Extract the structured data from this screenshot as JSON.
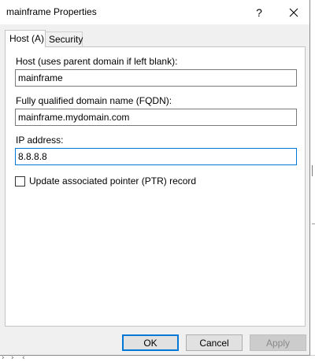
{
  "window": {
    "title": "mainframe Properties",
    "help_glyph": "?"
  },
  "tabs": [
    {
      "label": "Host (A)",
      "active": true
    },
    {
      "label": "Security",
      "active": false
    }
  ],
  "host": {
    "label": "Host (uses parent domain if left blank):",
    "value": "mainframe"
  },
  "fqdn": {
    "label": "Fully qualified domain name (FQDN):",
    "value": "mainframe.mydomain.com"
  },
  "ip": {
    "label": "IP address:",
    "value": "8.8.8.8"
  },
  "ptr": {
    "label": "Update associated pointer (PTR) record",
    "checked": false
  },
  "buttons": {
    "ok": "OK",
    "cancel": "Cancel",
    "apply": "Apply",
    "apply_enabled": false
  },
  "background": {
    "arrows": [
      "›",
      "›",
      "‹"
    ]
  },
  "colors": {
    "focus_accent": "#0078d7",
    "button_face": "#e1e1e1",
    "disabled_text": "#8a8a8a"
  }
}
